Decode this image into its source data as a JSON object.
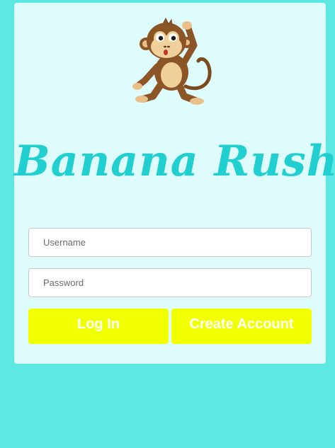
{
  "app": {
    "title": "Banana Rush",
    "mascot_icon": "monkey-icon"
  },
  "login_form": {
    "username_placeholder": "Username",
    "password_placeholder": "Password",
    "login_label": "Log In",
    "create_account_label": "Create Account"
  },
  "colors": {
    "page_background": "#5de8e4",
    "card_background": "#ddfcfb",
    "title_color": "#22cfd0",
    "button_background": "#f2ff00",
    "button_text": "#ffffff"
  }
}
